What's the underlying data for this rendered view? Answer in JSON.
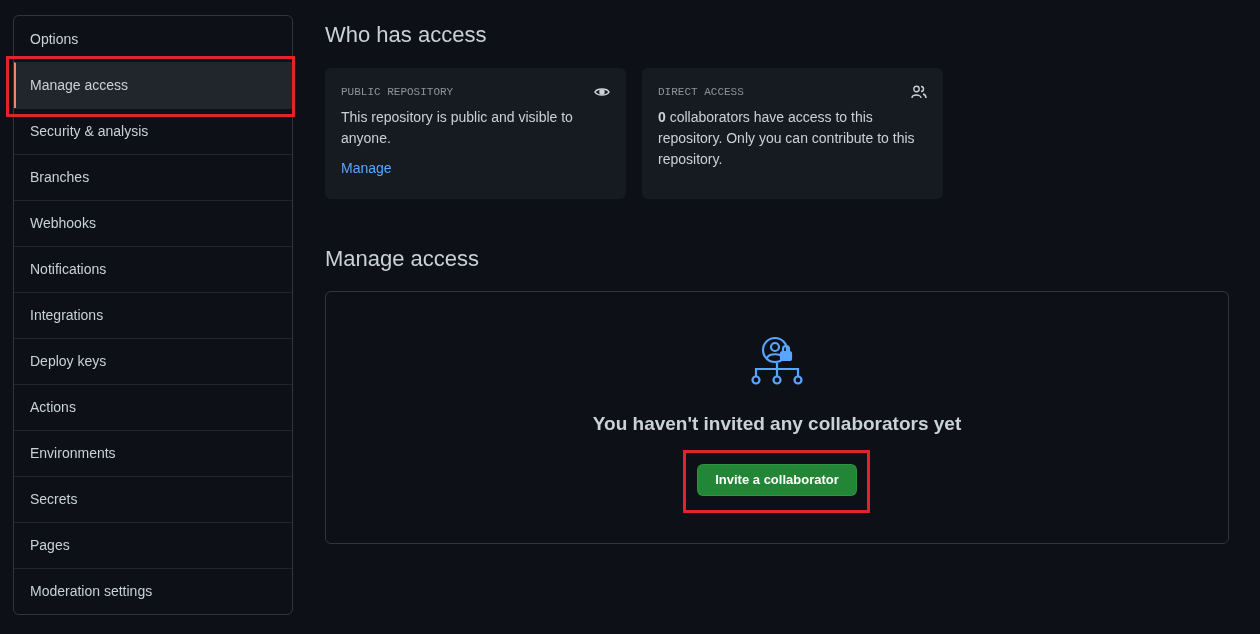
{
  "sidebar": {
    "items": [
      {
        "label": "Options",
        "selected": false,
        "highlighted": false
      },
      {
        "label": "Manage access",
        "selected": true,
        "highlighted": true
      },
      {
        "label": "Security & analysis",
        "selected": false,
        "highlighted": false
      },
      {
        "label": "Branches",
        "selected": false,
        "highlighted": false
      },
      {
        "label": "Webhooks",
        "selected": false,
        "highlighted": false
      },
      {
        "label": "Notifications",
        "selected": false,
        "highlighted": false
      },
      {
        "label": "Integrations",
        "selected": false,
        "highlighted": false
      },
      {
        "label": "Deploy keys",
        "selected": false,
        "highlighted": false
      },
      {
        "label": "Actions",
        "selected": false,
        "highlighted": false
      },
      {
        "label": "Environments",
        "selected": false,
        "highlighted": false
      },
      {
        "label": "Secrets",
        "selected": false,
        "highlighted": false
      },
      {
        "label": "Pages",
        "selected": false,
        "highlighted": false
      },
      {
        "label": "Moderation settings",
        "selected": false,
        "highlighted": false
      }
    ]
  },
  "who_has_access": {
    "title": "Who has access",
    "cards": [
      {
        "kind": "public",
        "heading": "PUBLIC REPOSITORY",
        "text": "This repository is public and visible to anyone.",
        "link": "Manage"
      },
      {
        "kind": "direct",
        "heading": "DIRECT ACCESS",
        "text": "**0** collaborators have access to this repository. Only you can contribute to this repository."
      }
    ]
  },
  "manage_access": {
    "title": "Manage access",
    "empty_message": "You haven't invited any collaborators yet",
    "button": {
      "label": "Invite a collaborator",
      "highlighted": true
    }
  }
}
